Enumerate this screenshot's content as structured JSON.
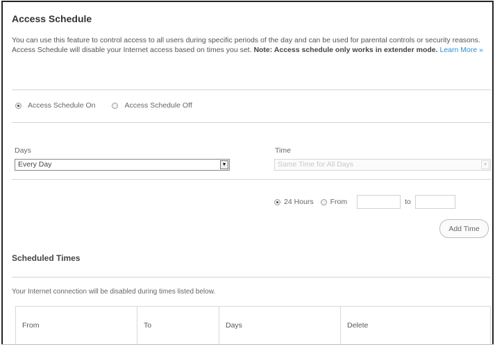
{
  "header": {
    "title": "Access Schedule",
    "intro_text": "You can use this feature to control access to all users during specific periods of the day and can be used for parental controls or security reasons. Access Schedule will disable your Internet access based on times you set.",
    "intro_note": "Note: Access schedule only works in extender mode.",
    "learn_more": "Learn More »"
  },
  "schedule_mode": {
    "on_label": "Access Schedule On",
    "off_label": "Access Schedule Off",
    "selected": "on"
  },
  "days": {
    "label": "Days",
    "selected": "Every Day"
  },
  "time": {
    "label": "Time",
    "selected": "Same Time for All Days",
    "disabled": true,
    "option_24h_label": "24 Hours",
    "option_from_label": "From",
    "to_label": "to",
    "selected_option": "24h",
    "from_value": "",
    "to_value": ""
  },
  "add_time_label": "Add Time",
  "scheduled": {
    "title": "Scheduled Times",
    "note": "Your Internet connection will be disabled during times listed below.",
    "columns": [
      "From",
      "To",
      "Days",
      "Delete"
    ]
  }
}
